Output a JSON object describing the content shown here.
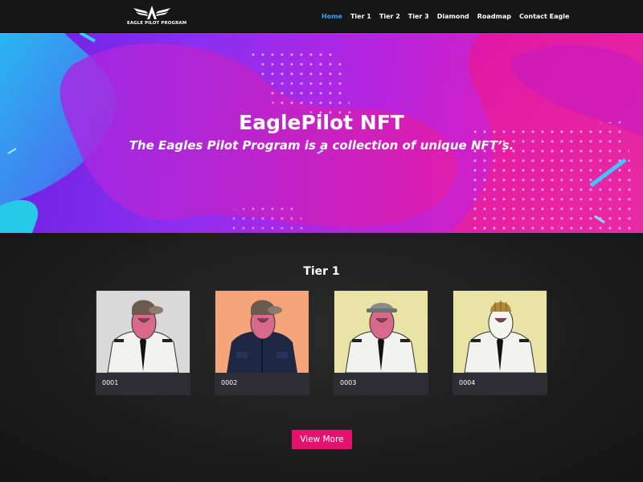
{
  "nav": {
    "logo_text": "EAGLE PILOT PROGRAM",
    "items": [
      "Home",
      "Tier 1",
      "Tier 2",
      "Tier 3",
      "Diamond",
      "Roadmap",
      "Contact Eagle"
    ],
    "active_index": 0,
    "active_color": "#2ea3f2"
  },
  "hero": {
    "title": "EaglePilot NFT",
    "subtitle": "The Eagles Pilot Program is a collection of unique NFT’s."
  },
  "tier": {
    "title": "Tier 1",
    "cards": [
      {
        "number": "0001",
        "bg": "#d9d9d9",
        "hat": "aviator-cap",
        "outfit": "white-uniform"
      },
      {
        "number": "0002",
        "bg": "#f6a57a",
        "hat": "aviator-cap",
        "outfit": "navy-jacket"
      },
      {
        "number": "0003",
        "bg": "#e9e4a6",
        "hat": "grey-cap",
        "outfit": "white-uniform"
      },
      {
        "number": "0004",
        "bg": "#e9e4a6",
        "hat": "gold-beanie",
        "outfit": "white-uniform"
      }
    ],
    "button_label": "View More",
    "button_color": "#e8106e"
  }
}
